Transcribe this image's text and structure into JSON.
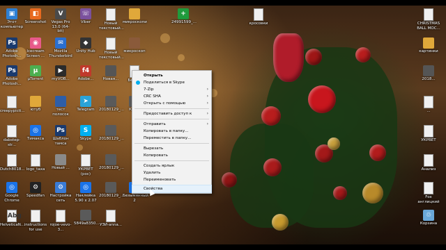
{
  "desktop": {
    "icons": [
      {
        "label": "Этот компьютер",
        "icon": "computer-icon",
        "color": "#2d7fd3",
        "ch": "▣"
      },
      {
        "label": "Screenshot",
        "icon": "screenshot-icon",
        "color": "#e86a1f",
        "ch": "◧"
      },
      {
        "label": "Vegas Pro 13.0 (64-bit)",
        "icon": "vegas-icon",
        "color": "#4a4a4a",
        "ch": "V"
      },
      {
        "label": "Viber",
        "icon": "viber-icon",
        "color": "#7b519d",
        "ch": "☏"
      },
      {
        "label": "Новый текстовый...",
        "icon": "text-file-icon",
        "color": "#f0f0f0",
        "ch": ""
      },
      {
        "label": "микроскопи",
        "icon": "folder-icon",
        "color": "#e0a83a",
        "ch": ""
      },
      {
        "label": "24991599_...",
        "icon": "green-plus-icon",
        "color": "#1f9a3c",
        "ch": "+"
      },
      {
        "label": "кросовки",
        "icon": "text-file-icon",
        "color": "#f0f0f0",
        "ch": ""
      },
      {
        "label": "CHRISTMAS BALL MOC...",
        "icon": "text-file-icon",
        "color": "#f0f0f0",
        "ch": ""
      },
      {
        "label": "Adobe Photosh...",
        "icon": "photoshop-icon",
        "color": "#1a3a6e",
        "ch": "Ps"
      },
      {
        "label": "Icecream Screen ...",
        "icon": "icecream-icon",
        "color": "#e85a8a",
        "ch": "◉"
      },
      {
        "label": "Mozilla Thunderbird",
        "icon": "thunderbird-icon",
        "color": "#2a6fd0",
        "ch": "✉"
      },
      {
        "label": "Unity Hub",
        "icon": "unity-icon",
        "color": "#333333",
        "ch": "◆"
      },
      {
        "label": "Новый текстовый...",
        "icon": "text-file-icon",
        "color": "#f0f0f0",
        "ch": ""
      },
      {
        "label": "микроскоп",
        "icon": "image-icon",
        "color": "#8a5a3a",
        "ch": ""
      },
      {
        "label": "картинки",
        "icon": "folder-icon",
        "color": "#e0a83a",
        "ch": ""
      },
      {
        "label": "Adobe Photosh...",
        "icon": "photoshop-icon",
        "color": "#1a3a6e",
        "ch": "Ps"
      },
      {
        "label": "µTorrent",
        "icon": "utorrent-icon",
        "color": "#4caf50",
        "ch": "µ"
      },
      {
        "label": "myVOB...",
        "icon": "app-icon",
        "color": "#2b2b2b",
        "ch": "▶"
      },
      {
        "label": "Adobe...",
        "icon": "adobe-icon",
        "color": "#c0392b",
        "ch": "f4"
      },
      {
        "label": "Новая...",
        "icon": "folder-icon",
        "color": "#555555",
        "ch": ""
      },
      {
        "label": "Бете...",
        "icon": "text-file-icon",
        "color": "#f0f0f0",
        "ch": ""
      },
      {
        "label": "2018...",
        "icon": "image-icon",
        "color": "#555555",
        "ch": ""
      },
      {
        "label": "creepypiсti...",
        "icon": "text-file-icon",
        "color": "#f0f0f0",
        "ch": ""
      },
      {
        "label": "ютуб",
        "icon": "folder-icon",
        "color": "#e0a83a",
        "ch": ""
      },
      {
        "label": "тест полосок",
        "icon": "image-icon",
        "color": "#2e5ea8",
        "ch": ""
      },
      {
        "label": "Telegram",
        "icon": "telegram-icon",
        "color": "#2aa3d8",
        "ch": "➤"
      },
      {
        "label": "20180129_...",
        "icon": "image-icon",
        "color": "#5a5a5a",
        "ch": ""
      },
      {
        "label": "Кол...",
        "icon": "image-icon",
        "color": "#5a5a5a",
        "ch": ""
      },
      {
        "label": "...",
        "icon": "text-file-icon",
        "color": "#f0f0f0",
        "ch": ""
      },
      {
        "label": "dabstep-str...",
        "icon": "text-file-icon",
        "color": "#f0f0f0",
        "ch": ""
      },
      {
        "label": "Тимакса",
        "icon": "chrome-icon",
        "color": "#1a73e8",
        "ch": "◎"
      },
      {
        "label": "Шаблон тамса",
        "icon": "photoshop-icon",
        "color": "#1a3a6e",
        "ch": "Ps"
      },
      {
        "label": "Skype",
        "icon": "skype-icon",
        "color": "#00aff0",
        "ch": "S"
      },
      {
        "label": "20180129_...",
        "icon": "image-icon",
        "color": "#5a5a5a",
        "ch": ""
      },
      {
        "label": "УКРВЕТ",
        "icon": "text-file-icon",
        "color": "#f0f0f0",
        "ch": ""
      },
      {
        "label": "Dutch8018...",
        "icon": "text-file-icon",
        "color": "#f0f0f0",
        "ch": ""
      },
      {
        "label": "logo_taxa",
        "icon": "image-icon",
        "color": "#f0f0f0",
        "ch": ""
      },
      {
        "label": "Новый ...",
        "icon": "image-icon",
        "color": "#8a8a8a",
        "ch": ""
      },
      {
        "label": "УКРВЕТ (рос)",
        "icon": "text-file-icon",
        "color": "#f0f0f0",
        "ch": ""
      },
      {
        "label": "20180129_...",
        "icon": "image-icon",
        "color": "#5a5a5a",
        "ch": ""
      },
      {
        "label": "Анализ",
        "icon": "text-file-icon",
        "color": "#f0f0f0",
        "ch": ""
      },
      {
        "label": "Google Chrome",
        "icon": "chrome-icon",
        "color": "#1a73e8",
        "ch": "◎"
      },
      {
        "label": "Speedfan",
        "icon": "speedfan-icon",
        "color": "#222222",
        "ch": "⚙"
      },
      {
        "label": "Настройка сеть",
        "icon": "settings-icon",
        "color": "#3a7bd5",
        "ch": "⚙"
      },
      {
        "label": "Наклейка 5.90 x 2.07",
        "icon": "chrome-icon",
        "color": "#1a73e8",
        "ch": "◎"
      },
      {
        "label": "20180129_...",
        "icon": "image-icon",
        "color": "#5a5a5a",
        "ch": ""
      },
      {
        "label": "Безымянный 2",
        "icon": "chrome-icon",
        "color": "#1a73e8",
        "ch": "◎"
      },
      {
        "label": "Fox англицкий",
        "icon": "text-file-icon",
        "color": "#f0f0f0",
        "ch": ""
      },
      {
        "label": "HelveticaN...",
        "icon": "font-file-icon",
        "color": "#f0f0f0",
        "ch": "Abg"
      },
      {
        "label": "instructions for use",
        "icon": "text-file-icon",
        "color": "#f0f0f0",
        "ch": ""
      },
      {
        "label": "rojoe-vevo-3...",
        "icon": "text-file-icon",
        "color": "#f0f0f0",
        "ch": ""
      },
      {
        "label": "5849a8350...",
        "icon": "image-icon",
        "color": "#5a5a5a",
        "ch": ""
      },
      {
        "label": "УЗИ-anna...",
        "icon": "text-file-icon",
        "color": "#f0f0f0",
        "ch": ""
      },
      {
        "label": "Корзина",
        "icon": "recycle-bin-icon",
        "color": "#6aa8d8",
        "ch": "♲"
      }
    ]
  },
  "context_menu": {
    "items": [
      {
        "label": "Открыть",
        "bold": true,
        "has_submenu": false,
        "name": "menu-item-open",
        "icon": ""
      },
      {
        "label": "Поделиться в Skype",
        "bold": false,
        "has_submenu": false,
        "name": "menu-item-share-skype",
        "icon": "skype-icon"
      },
      {
        "label": "7-Zip",
        "bold": false,
        "has_submenu": true,
        "name": "menu-item-7zip",
        "icon": ""
      },
      {
        "label": "CRC SHA",
        "bold": false,
        "has_submenu": true,
        "name": "menu-item-crc-sha",
        "icon": ""
      },
      {
        "label": "Открыть с помощью",
        "bold": false,
        "has_submenu": true,
        "name": "menu-item-open-with",
        "icon": ""
      },
      {
        "label": "Предоставить доступ к",
        "bold": false,
        "has_submenu": true,
        "name": "menu-item-share-access",
        "icon": ""
      },
      {
        "label": "Отправить",
        "bold": false,
        "has_submenu": true,
        "name": "menu-item-send-to",
        "icon": ""
      },
      {
        "label": "Копировать в папку...",
        "bold": false,
        "has_submenu": false,
        "name": "menu-item-copy-to-folder",
        "icon": ""
      },
      {
        "label": "Переместить в папку...",
        "bold": false,
        "has_submenu": false,
        "name": "menu-item-move-to-folder",
        "icon": ""
      },
      {
        "label": "Вырезать",
        "bold": false,
        "has_submenu": false,
        "name": "menu-item-cut",
        "icon": ""
      },
      {
        "label": "Копировать",
        "bold": false,
        "has_submenu": false,
        "name": "menu-item-copy",
        "icon": ""
      },
      {
        "label": "Создать ярлык",
        "bold": false,
        "has_submenu": false,
        "name": "menu-item-create-shortcut",
        "icon": ""
      },
      {
        "label": "Удалить",
        "bold": false,
        "has_submenu": false,
        "name": "menu-item-delete",
        "icon": ""
      },
      {
        "label": "Переименовать",
        "bold": false,
        "has_submenu": false,
        "name": "menu-item-rename",
        "icon": ""
      },
      {
        "label": "Свойства",
        "bold": false,
        "has_submenu": false,
        "name": "menu-item-properties",
        "icon": ""
      }
    ],
    "submenu_arrow": "›"
  }
}
